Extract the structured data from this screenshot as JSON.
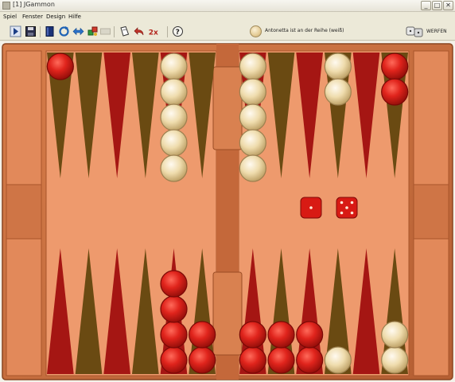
{
  "window": {
    "title": "[1] JGammon",
    "minimize_glyph": "_",
    "maximize_glyph": "□",
    "close_glyph": "✕"
  },
  "menu": {
    "items": [
      "Spiel",
      "Fenster",
      "Design",
      "Hilfe"
    ]
  },
  "toolbar": {
    "buttons": [
      "play-icon",
      "save-icon",
      "book-icon",
      "refresh-icon",
      "swap-icon",
      "puzzle-icon",
      "blank-icon",
      "paper-icon",
      "undo-icon",
      "double-icon",
      "help-icon"
    ],
    "double_label": "2x",
    "help_label": "?"
  },
  "status": {
    "text": "Antonetta ist an der Reihe (weiß)",
    "player_color": "#ecd6a6"
  },
  "roll_button": {
    "label": "WERFEN"
  },
  "dice": [
    {
      "value": 1
    },
    {
      "value": 5
    }
  ],
  "board_colors": {
    "frame": "#c86f3f",
    "felt": "#ee9a6d",
    "point_red": "#a51613",
    "point_olive": "#6a4a12",
    "checker_red": "#d91b17",
    "checker_cream": "#edd9ab"
  },
  "points": {
    "top": [
      {
        "color": "olive",
        "checkers": "red",
        "count": 1
      },
      {
        "color": "olive",
        "checkers": "",
        "count": 0
      },
      {
        "color": "red",
        "checkers": "",
        "count": 0
      },
      {
        "color": "olive",
        "checkers": "",
        "count": 0
      },
      {
        "color": "red",
        "checkers": "cream",
        "count": 5
      },
      {
        "color": "olive",
        "checkers": "",
        "count": 0
      },
      {
        "color": "red",
        "checkers": "cream",
        "count": 5
      },
      {
        "color": "olive",
        "checkers": "",
        "count": 0
      },
      {
        "color": "red",
        "checkers": "",
        "count": 0
      },
      {
        "color": "olive",
        "checkers": "cream",
        "count": 2
      },
      {
        "color": "red",
        "checkers": "",
        "count": 0
      },
      {
        "color": "olive",
        "checkers": "red",
        "count": 2
      }
    ],
    "bottom": [
      {
        "color": "red",
        "checkers": "",
        "count": 0
      },
      {
        "color": "olive",
        "checkers": "",
        "count": 0
      },
      {
        "color": "red",
        "checkers": "",
        "count": 0
      },
      {
        "color": "olive",
        "checkers": "",
        "count": 0
      },
      {
        "color": "red",
        "checkers": "red",
        "count": 4
      },
      {
        "color": "olive",
        "checkers": "red",
        "count": 2
      },
      {
        "color": "red",
        "checkers": "red",
        "count": 2
      },
      {
        "color": "olive",
        "checkers": "red",
        "count": 2
      },
      {
        "color": "red",
        "checkers": "red",
        "count": 2
      },
      {
        "color": "olive",
        "checkers": "cream",
        "count": 1
      },
      {
        "color": "red",
        "checkers": "",
        "count": 0
      },
      {
        "color": "olive",
        "checkers": "cream",
        "count": 2
      }
    ]
  }
}
